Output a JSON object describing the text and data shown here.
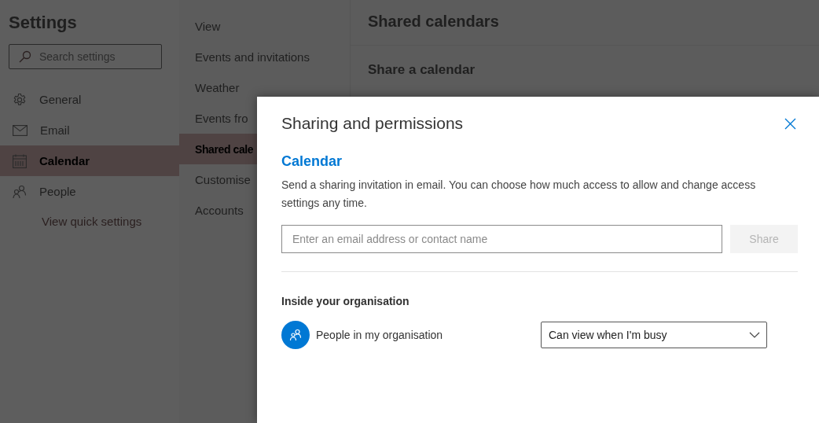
{
  "sidebar": {
    "title": "Settings",
    "search": {
      "placeholder": "Search settings"
    },
    "items": [
      {
        "label": "General",
        "selected": false
      },
      {
        "label": "Email",
        "selected": false
      },
      {
        "label": "Calendar",
        "selected": true
      },
      {
        "label": "People",
        "selected": false
      }
    ],
    "link": "View quick settings"
  },
  "submenu": {
    "items": [
      {
        "label": "View",
        "selected": false
      },
      {
        "label": "Events and invitations",
        "selected": false
      },
      {
        "label": "Weather",
        "selected": false
      },
      {
        "label": "Events fro",
        "selected": false
      },
      {
        "label": "Shared cale",
        "selected": true
      },
      {
        "label": "Customise",
        "selected": false
      },
      {
        "label": "Accounts",
        "selected": false
      }
    ]
  },
  "content": {
    "title": "Shared calendars",
    "section": "Share a calendar"
  },
  "dialog": {
    "title": "Sharing and permissions",
    "heading": "Calendar",
    "description": "Send a sharing invitation in email. You can choose how much access to allow and change access settings any time.",
    "email_field": {
      "placeholder": "Enter an email address or contact name"
    },
    "share_button": {
      "label": "Share",
      "disabled": true
    },
    "section_title": "Inside your organisation",
    "permissions": [
      {
        "name": "People in my organisation",
        "role": "Can view when I'm busy"
      }
    ]
  }
}
